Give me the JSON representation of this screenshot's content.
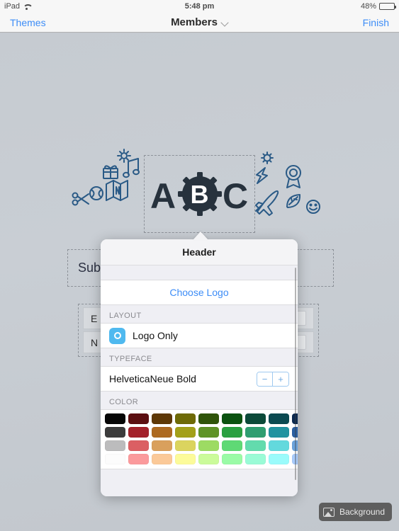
{
  "statusbar": {
    "device": "iPad",
    "wifi_icon": "wifi-icon",
    "time": "5:48 pm",
    "battery_percent": "48%",
    "battery_level": 48
  },
  "navbar": {
    "left_label": "Themes",
    "title": "Members",
    "chevron_icon": "chevron-down-icon",
    "right_label": "Finish"
  },
  "canvas": {
    "logo_text": "ABC",
    "headline_text": "Submit your best photo to win",
    "form_rows": [
      {
        "label": "E"
      },
      {
        "label": "N"
      }
    ],
    "doodle_icons_left": [
      "scissors-icon",
      "ball-icon",
      "map-icon",
      "gift-icon",
      "music-note-icon",
      "sun-icon"
    ],
    "doodle_icons_right": [
      "gear-icon",
      "lightning-icon",
      "award-ribbon-icon",
      "airplane-icon",
      "leaf-icon",
      "smiley-icon"
    ]
  },
  "popover": {
    "title": "Header",
    "choose_logo_label": "Choose Logo",
    "layout": {
      "section_label": "LAYOUT",
      "selected": "Logo Only",
      "icon": "logo-only-icon"
    },
    "typeface": {
      "section_label": "TYPEFACE",
      "value": "HelveticaNeue Bold",
      "decrease_label": "−",
      "increase_label": "+"
    },
    "color": {
      "section_label": "COLOR",
      "rows": [
        [
          "#060606",
          "#5c0f11",
          "#5e3806",
          "#6e6a06",
          "#2f5409",
          "#0b5210",
          "#0c4a39",
          "#0b4a51",
          "#0c2a50"
        ],
        [
          "#3c3c3c",
          "#a3212a",
          "#ad6a21",
          "#a3a019",
          "#5f9327",
          "#2aa041",
          "#2f9e71",
          "#2193a0",
          "#2a5fa2"
        ],
        [
          "#bcbcbd",
          "#db5f63",
          "#d9a05d",
          "#dbd45f",
          "#9ddb63",
          "#5fd975",
          "#63dbad",
          "#63d9dd",
          "#6ba3dc"
        ],
        [
          "#fcfcfc",
          "#fb9a9c",
          "#fbc998",
          "#fcfb9a",
          "#cbfb9a",
          "#9afba6",
          "#9afbd6",
          "#9afbfb",
          "#a8cbfb"
        ]
      ]
    }
  },
  "background_button": {
    "label": "Background",
    "icon": "image-icon"
  },
  "accent_colors": {
    "tint_blue": "#3d8df7",
    "layout_icon_blue": "#4fb9ef"
  }
}
